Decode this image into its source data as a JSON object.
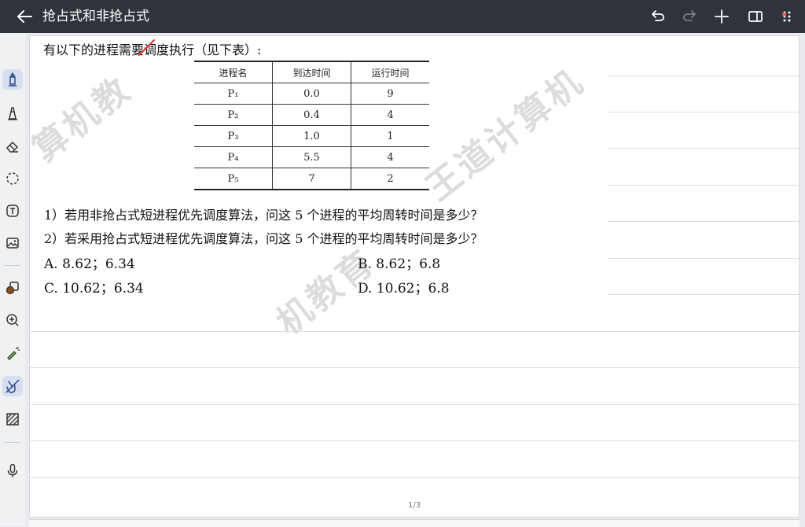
{
  "header": {
    "title": "抢占式和非抢占式",
    "icons": [
      "back-arrow-icon",
      "undo-icon",
      "redo-icon",
      "add-icon",
      "split-view-icon",
      "more-icon"
    ]
  },
  "toolbar": {
    "tools": [
      "pen-icon",
      "highlighter-icon",
      "eraser-icon",
      "lasso-icon",
      "text-icon",
      "image-icon",
      "shapes-icon",
      "zoom-icon",
      "laser-pointer-icon",
      "hand-draw-icon",
      "pattern-icon",
      "microphone-icon"
    ],
    "active": [
      "pen-icon",
      "hand-draw-icon"
    ]
  },
  "document": {
    "intro": "有以下的进程需要调度执行（见下表）:",
    "table": {
      "headers": [
        "进程名",
        "到达时间",
        "运行时间"
      ],
      "rows": [
        [
          "P₁",
          "0.0",
          "9"
        ],
        [
          "P₂",
          "0.4",
          "4"
        ],
        [
          "P₃",
          "1.0",
          "1"
        ],
        [
          "P₄",
          "5.5",
          "4"
        ],
        [
          "P₅",
          "7",
          "2"
        ]
      ]
    },
    "q1": "1）若用非抢占式短进程优先调度算法，问这 5 个进程的平均周转时间是多少？",
    "q2": "2）若采用抢占式短进程优先调度算法，问这 5 个进程的平均周转时间是多少？",
    "options": {
      "A": "A.   8.62；6.34",
      "B": "B.   8.62；6.8",
      "C": "C.   10.62；6.34",
      "D": "D.   10.62；6.8"
    },
    "watermarks": [
      "算机教",
      "王道计算机",
      "机教育"
    ]
  },
  "page_indicator": "1/3",
  "colors": {
    "topbar": "#2f343c",
    "active_tool": "#d6def1",
    "strike": "#e0342b"
  }
}
